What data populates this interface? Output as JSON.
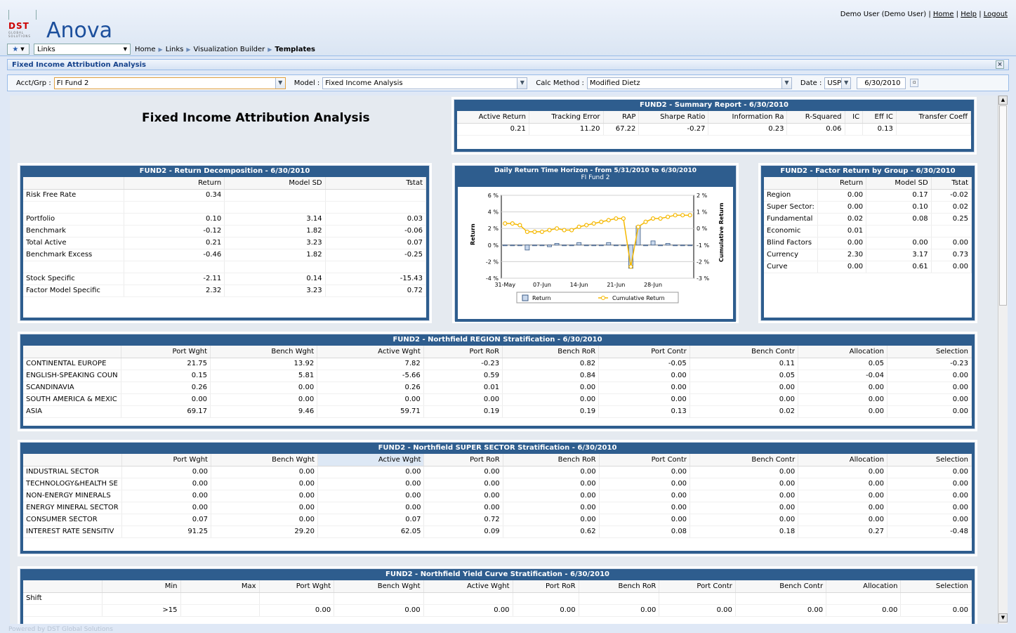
{
  "header": {
    "logo_main": "DST",
    "logo_sub": "GLOBAL SOLUTIONS",
    "app_name": "Anova",
    "user": "Demo User (Demo User)",
    "home": "Home",
    "help": "Help",
    "logout": "Logout",
    "sep": "|"
  },
  "nav": {
    "links_value": "Links",
    "breadcrumb": [
      "Home",
      "Links",
      "Visualization Builder"
    ],
    "current": "Templates"
  },
  "titlebar": {
    "title": "Fixed Income Attribution Analysis"
  },
  "filters": {
    "acct_label": "Acct/Grp :",
    "acct_value": "FI Fund 2",
    "model_label": "Model :",
    "model_value": "Fixed Income Analysis",
    "calc_label": "Calc Method :",
    "calc_value": "Modified Dietz",
    "date_label": "Date :",
    "currency": "USP",
    "date_value": "6/30/2010"
  },
  "page_title": "Fixed Income Attribution Analysis",
  "summary": {
    "title": "FUND2 - Summary Report - 6/30/2010",
    "headers": [
      "Active Return",
      "Tracking Error",
      "RAP",
      "Sharpe Ratio",
      "Information Ra",
      "R-Squared",
      "IC",
      "Eff IC",
      "Transfer Coeff"
    ],
    "row": [
      "0.21",
      "11.20",
      "67.22",
      "-0.27",
      "0.23",
      "0.06",
      "",
      "0.13",
      ""
    ]
  },
  "decomp": {
    "title": "FUND2 - Return Decomposition - 6/30/2010",
    "headers": [
      "",
      "Return",
      "Model SD",
      "Tstat"
    ],
    "rows": [
      [
        "Risk Free Rate",
        "0.34",
        "",
        ""
      ],
      [
        "",
        "",
        "",
        ""
      ],
      [
        "Portfolio",
        "0.10",
        "3.14",
        "0.03"
      ],
      [
        "Benchmark",
        "-0.12",
        "1.82",
        "-0.06"
      ],
      [
        "Total Active",
        "0.21",
        "3.23",
        "0.07"
      ],
      [
        "Benchmark Excess",
        "-0.46",
        "1.82",
        "-0.25"
      ],
      [
        "",
        "",
        "",
        ""
      ],
      [
        "Stock Specific",
        "-2.11",
        "0.14",
        "-15.43"
      ],
      [
        "Factor Model Specific",
        "2.32",
        "3.23",
        "0.72"
      ]
    ]
  },
  "chart_data": {
    "type": "bar",
    "title": "Daily Return Time Horizon - from 5/31/2010 to 6/30/2010",
    "subtitle": "FI Fund 2",
    "ylabel": "Return",
    "y2label": "Cumulative Return",
    "ylim": [
      -4,
      6
    ],
    "y2lim": [
      -3,
      2
    ],
    "yticks": [
      "6 %",
      "4 %",
      "2 %",
      "0 %",
      "-2 %",
      "-4 %"
    ],
    "y2ticks": [
      "2 %",
      "1 %",
      "0 %",
      "-1 %",
      "-2 %",
      "-3 %"
    ],
    "xticks": [
      "31-May",
      "07-Jun",
      "14-Jun",
      "21-Jun",
      "28-Jun"
    ],
    "series": [
      {
        "name": "Return",
        "values": [
          0.0,
          0.0,
          0.0,
          -0.6,
          0.0,
          0.0,
          -0.2,
          0.2,
          0.0,
          0.0,
          0.3,
          0.0,
          0.0,
          0.0,
          0.3,
          0.0,
          0.0,
          -2.8,
          2.3,
          0.0,
          0.5,
          0.0,
          0.2,
          0.0,
          0.0,
          0.0
        ]
      },
      {
        "name": "Cumulative Return",
        "values": [
          0.3,
          0.3,
          0.2,
          -0.2,
          -0.2,
          -0.2,
          -0.1,
          0.0,
          -0.1,
          -0.1,
          0.1,
          0.2,
          0.3,
          0.4,
          0.5,
          0.6,
          0.6,
          -2.3,
          0.1,
          0.4,
          0.6,
          0.6,
          0.7,
          0.8,
          0.8,
          0.8
        ]
      }
    ],
    "legend": "bottom"
  },
  "factor": {
    "title": "FUND2 - Factor Return by Group - 6/30/2010",
    "headers": [
      "",
      "Return",
      "Model SD",
      "Tstat"
    ],
    "rows": [
      [
        "Region",
        "0.00",
        "0.17",
        "-0.02"
      ],
      [
        "Super Sector:",
        "0.00",
        "0.10",
        "0.02"
      ],
      [
        "Fundamental",
        "0.02",
        "0.08",
        "0.25"
      ],
      [
        "Economic",
        "0.01",
        "",
        ""
      ],
      [
        "Blind Factors",
        "0.00",
        "0.00",
        "0.00"
      ],
      [
        "Currency",
        "2.30",
        "3.17",
        "0.73"
      ],
      [
        "Curve",
        "0.00",
        "0.61",
        "0.00"
      ]
    ]
  },
  "region": {
    "title": "FUND2 - Northfield REGION Stratification - 6/30/2010",
    "headers": [
      "",
      "Port Wght",
      "Bench Wght",
      "Active Wght",
      "Port RoR",
      "Bench RoR",
      "Port Contr",
      "Bench Contr",
      "Allocation",
      "Selection"
    ],
    "rows": [
      [
        "CONTINENTAL EUROPE",
        "21.75",
        "13.92",
        "7.82",
        "-0.23",
        "0.82",
        "-0.05",
        "0.11",
        "0.05",
        "-0.23"
      ],
      [
        "ENGLISH-SPEAKING COUN",
        "0.15",
        "5.81",
        "-5.66",
        "0.59",
        "0.84",
        "0.00",
        "0.05",
        "-0.04",
        "0.00"
      ],
      [
        "SCANDINAVIA",
        "0.26",
        "0.00",
        "0.26",
        "0.01",
        "0.00",
        "0.00",
        "0.00",
        "0.00",
        "0.00"
      ],
      [
        "SOUTH AMERICA & MEXIC",
        "0.00",
        "0.00",
        "0.00",
        "0.00",
        "0.00",
        "0.00",
        "0.00",
        "0.00",
        "0.00"
      ],
      [
        "ASIA",
        "69.17",
        "9.46",
        "59.71",
        "0.19",
        "0.19",
        "0.13",
        "0.02",
        "0.00",
        "0.00"
      ]
    ]
  },
  "sector": {
    "title": "FUND2 - Northfield SUPER SECTOR Stratification - 6/30/2010",
    "headers": [
      "",
      "Port Wght",
      "Bench Wght",
      "Active Wght",
      "Port RoR",
      "Bench RoR",
      "Port Contr",
      "Bench Contr",
      "Allocation",
      "Selection"
    ],
    "rows": [
      [
        "INDUSTRIAL SECTOR",
        "0.00",
        "0.00",
        "0.00",
        "0.00",
        "0.00",
        "0.00",
        "0.00",
        "0.00",
        "0.00"
      ],
      [
        "TECHNOLOGY&HEALTH SE",
        "0.00",
        "0.00",
        "0.00",
        "0.00",
        "0.00",
        "0.00",
        "0.00",
        "0.00",
        "0.00"
      ],
      [
        "NON-ENERGY MINERALS",
        "0.00",
        "0.00",
        "0.00",
        "0.00",
        "0.00",
        "0.00",
        "0.00",
        "0.00",
        "0.00"
      ],
      [
        "ENERGY MINERAL SECTOR",
        "0.00",
        "0.00",
        "0.00",
        "0.00",
        "0.00",
        "0.00",
        "0.00",
        "0.00",
        "0.00"
      ],
      [
        "CONSUMER SECTOR",
        "0.07",
        "0.00",
        "0.07",
        "0.72",
        "0.00",
        "0.00",
        "0.00",
        "0.00",
        "0.00"
      ],
      [
        "INTEREST RATE SENSITIV",
        "91.25",
        "29.20",
        "62.05",
        "0.09",
        "0.62",
        "0.08",
        "0.18",
        "0.27",
        "-0.48"
      ]
    ]
  },
  "yield": {
    "title": "FUND2 - Northfield Yield Curve Stratification - 6/30/2010",
    "headers": [
      "",
      "Min",
      "Max",
      "Port Wght",
      "Bench Wght",
      "Active Wght",
      "Port RoR",
      "Bench RoR",
      "Port Contr",
      "Bench Contr",
      "Allocation",
      "Selection"
    ],
    "rows": [
      [
        "Shift",
        "",
        "",
        "",
        "",
        "",
        "",
        "",
        "",
        "",
        "",
        ""
      ],
      [
        "",
        ">15",
        "",
        "0.00",
        "0.00",
        "0.00",
        "0.00",
        "0.00",
        "0.00",
        "0.00",
        "0.00",
        "0.00"
      ]
    ]
  },
  "footer": "Powered by DST Global Solutions"
}
